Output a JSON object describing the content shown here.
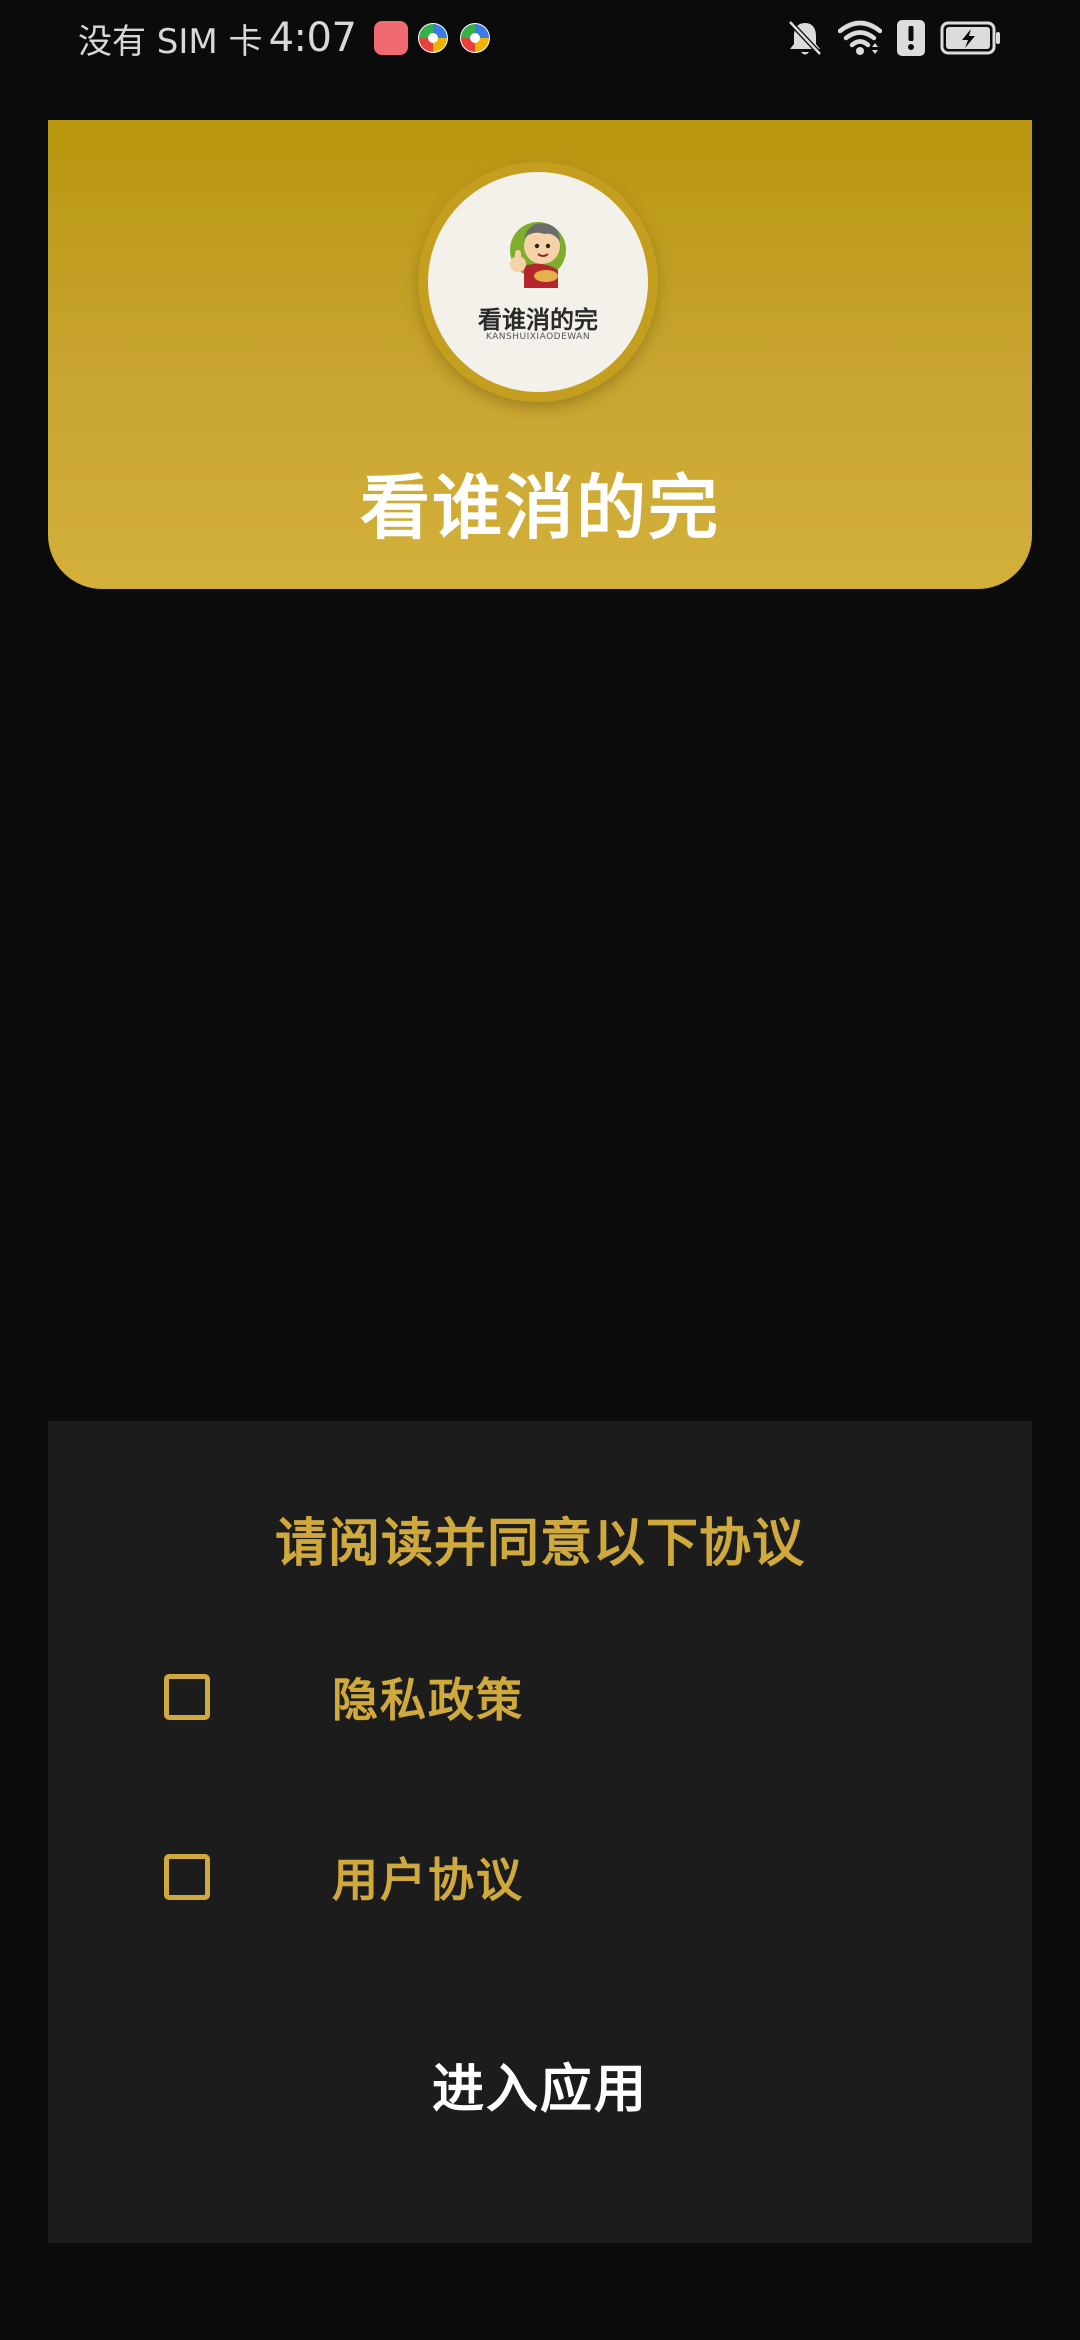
{
  "status_bar": {
    "carrier": "没有 SIM 卡",
    "time": "4:07",
    "left_icons": [
      "huawei-appgallery-icon",
      "app-notification-icon",
      "app-notification-icon"
    ],
    "right_icons": [
      "bell-muted-icon",
      "wifi-icon",
      "alert-icon",
      "battery-charging-icon"
    ]
  },
  "header": {
    "logo_text": "看谁消的完",
    "logo_subtext": "KANSHUIXIAODEWAN",
    "title": "看谁消的完"
  },
  "agreement": {
    "title": "请阅读并同意以下协议",
    "items": [
      {
        "label": "隐私政策",
        "checked": false
      },
      {
        "label": "用户协议",
        "checked": false
      }
    ],
    "enter_label": "进入应用"
  },
  "colors": {
    "accent": "#cfa93c",
    "header_top": "#b8960f",
    "header_bottom": "#d3b03a",
    "background": "#0b0b0b",
    "panel": "#1c1c1c"
  }
}
